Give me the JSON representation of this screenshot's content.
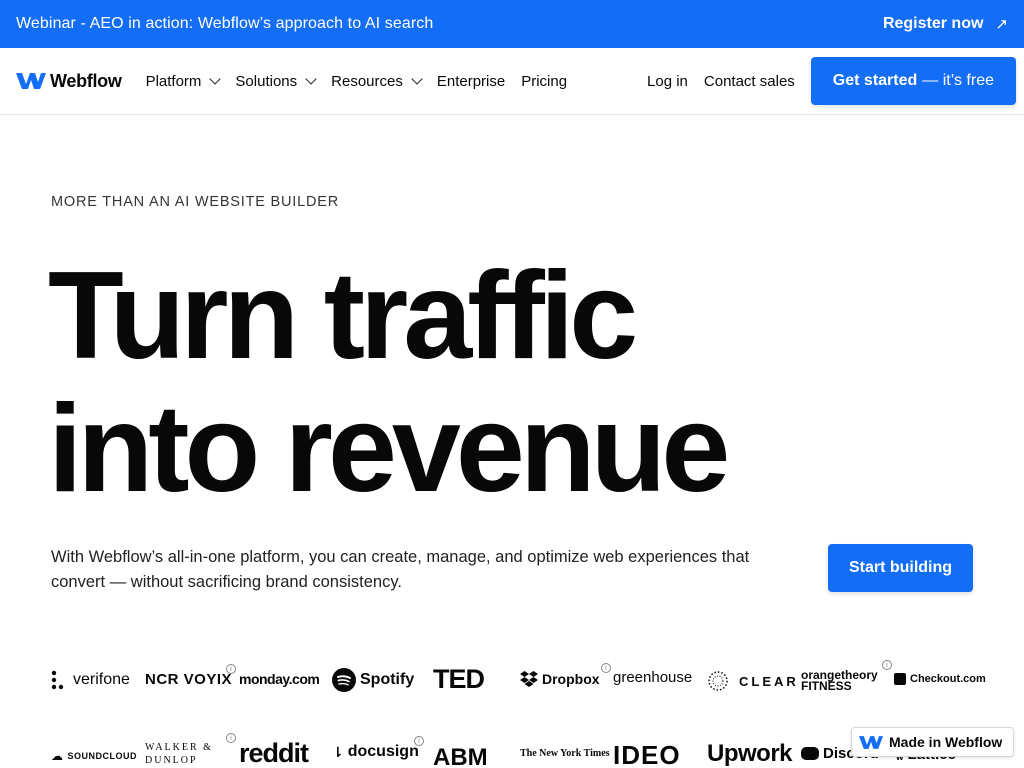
{
  "banner": {
    "text": "Webinar - AEO in action: Webflow’s approach to AI search",
    "cta_label": "Register now",
    "cta_icon": "arrow-up-right-icon",
    "background": "#146ef5"
  },
  "nav": {
    "logo_text": "Webflow",
    "items": [
      {
        "label": "Platform",
        "has_dropdown": true
      },
      {
        "label": "Solutions",
        "has_dropdown": true
      },
      {
        "label": "Resources",
        "has_dropdown": true
      },
      {
        "label": "Enterprise",
        "has_dropdown": false
      },
      {
        "label": "Pricing",
        "has_dropdown": false
      }
    ],
    "login_label": "Log in",
    "contact_label": "Contact sales",
    "get_started_bold": "Get started",
    "get_started_rest": "— it’s free"
  },
  "hero": {
    "eyebrow": "MORE THAN AN AI WEBSITE BUILDER",
    "headline_line1": "Turn traffic",
    "headline_line2": "into revenue",
    "subtext": "With Webflow’s all-in-one platform, you can create, manage, and optimize web experiences that convert — without sacrificing brand consistency.",
    "cta_label": "Start building"
  },
  "logos": {
    "row1": [
      "verifone",
      "NCR VOYIX",
      "monday.com",
      "Spotify",
      "TED",
      "Dropbox",
      "greenhouse",
      "CLEAR",
      "orangetheory FITNESS",
      "Checkout.com"
    ],
    "row2": [
      "SOUNDCLOUD",
      "WALKER & DUNLOP",
      "reddit",
      "docusign",
      "ABM",
      "The New York Times",
      "IDEO",
      "Upwork",
      "Discord",
      "Lattice"
    ],
    "info_icon_glyph": "i"
  },
  "badge": {
    "label": "Made in Webflow"
  },
  "colors": {
    "accent": "#146ef5",
    "text": "#080808"
  }
}
